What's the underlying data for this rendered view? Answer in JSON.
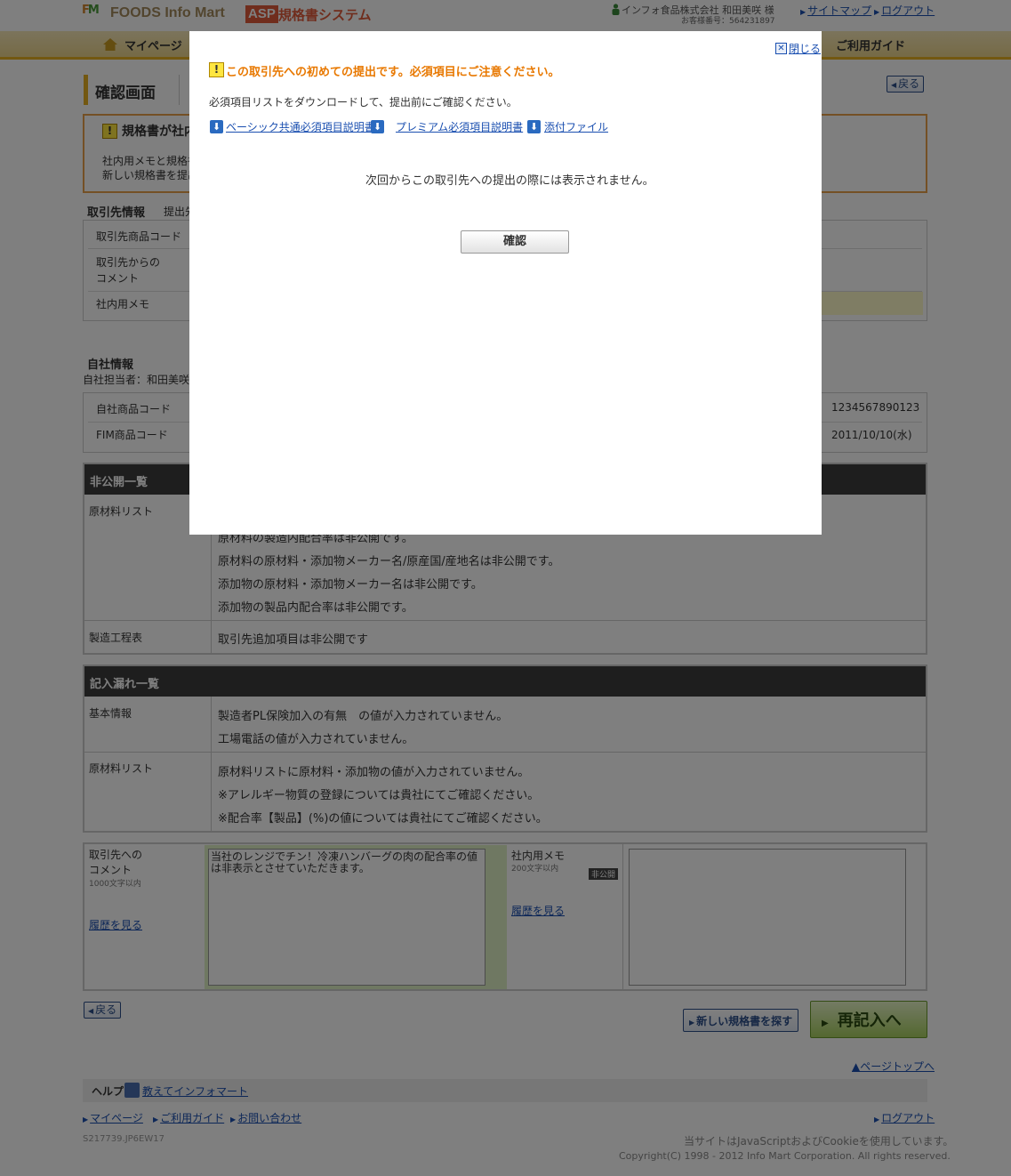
{
  "header": {
    "logo_foods": "FOODS Info Mart",
    "logo_asp": "ASP",
    "logo_system": "規格書システム",
    "user_name": "インフォ食品株式会社 和田美咲 様",
    "customer_no": "お客様番号：564231897",
    "sitemap": "サイトマップ",
    "logout": "ログアウト"
  },
  "nav": {
    "mypage": "マイページ",
    "guide": "ご利用ガイド"
  },
  "page": {
    "title": "確認画面",
    "back": "戻る",
    "notice_title": "規格書が社内",
    "notice_line1": "社内用メモと規格書",
    "notice_line2": "新しい規格書を提出"
  },
  "partner": {
    "heading": "取引先情報",
    "sub": "提出先",
    "rows": [
      "取引先商品コード",
      "取引先からの",
      "コメント",
      "社内用メモ"
    ]
  },
  "own": {
    "heading": "自社情報",
    "sub": "自社担当者：和田美咲",
    "rows": [
      "自社商品コード",
      "FIM商品コード"
    ],
    "values": [
      "1234567890123",
      "2011/10/10(水)"
    ]
  },
  "private_list": {
    "heading": "非公開一覧",
    "label_materials": "原材料リスト",
    "label_process": "製造工程表",
    "lines": [
      "原材料の製造内配合率は非公開です。",
      "原材料の原材料・添加物メーカー名/原産国/産地名は非公開です。",
      "添加物の原材料・添加物メーカー名は非公開です。",
      "添加物の製品内配合率は非公開です。"
    ],
    "process_value": "取引先追加項目は非公開です"
  },
  "missing_list": {
    "heading": "記入漏れ一覧",
    "label_basic": "基本情報",
    "label_materials": "原材料リスト",
    "basic_lines": [
      "製造者PL保険加入の有無　の値が入力されていません。",
      "工場電話の値が入力されていません。"
    ],
    "material_lines": [
      "原材料リストに原材料・添加物の値が入力されていません。",
      "※アレルギー物質の登録については貴社にてご確認ください。",
      "※配合率【製品】(%)の値については貴社にてご確認ください。"
    ]
  },
  "comments": {
    "to_partner_label1": "取引先への",
    "to_partner_label2": "コメント",
    "to_partner_limit": "1000文字以内",
    "to_partner_history": "履歴を見る",
    "to_partner_text": "当社のレンジでチン！冷凍ハンバーグの肉の配合率の値は非表示とさせていただきます。",
    "memo_label": "社内用メモ",
    "memo_limit": "200文字以内",
    "memo_private": "非公開",
    "memo_history": "履歴を見る",
    "memo_text": ""
  },
  "actions": {
    "back": "戻る",
    "new_spec": "新しい規格書を探す",
    "reenter": "再記入へ",
    "page_top": "▲ページトップへ"
  },
  "footer": {
    "help": "ヘルプ",
    "help_link": "教えてインフォマート",
    "mypage": "マイページ",
    "guide": "ご利用ガイド",
    "contact": "お問い合わせ",
    "logout": "ログアウト",
    "code": "S217739.JP6EW17",
    "js_notice": "当サイトはJavaScriptおよびCookieを使用しています。",
    "copyright": "Copyright(C) 1998 - 2012 Info Mart Corporation. All rights reserved."
  },
  "modal": {
    "close": "閉じる",
    "title": "この取引先への初めての提出です。必須項目にご注意ください。",
    "download_text": "必須項目リストをダウンロードして、提出前にご確認ください。",
    "link_basic": "ベーシック共通必須項目説明書",
    "link_premium": "プレミアム必須項目説明書",
    "link_attach": "添付ファイル",
    "next_time": "次回からこの取引先への提出の際には表示されません。",
    "confirm": "確認"
  }
}
